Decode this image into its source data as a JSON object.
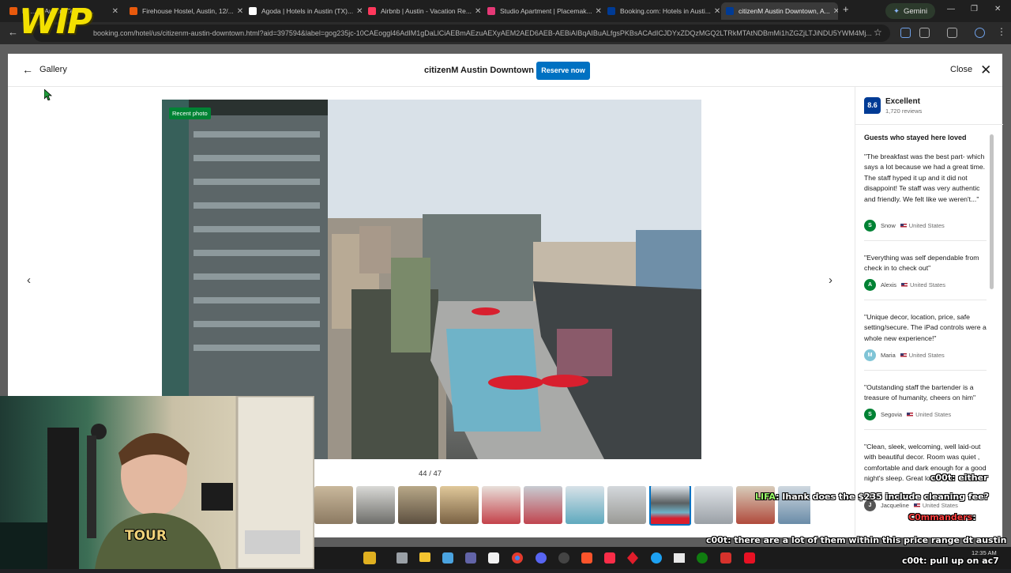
{
  "browser": {
    "tabs": [
      {
        "label": "Ba... in Austin, Texas, ...",
        "color": "#e8590c"
      },
      {
        "label": "Firehouse Hostel, Austin, 12/...",
        "color": "#e8590c"
      },
      {
        "label": "Agoda | Hotels in Austin (TX)...",
        "color": "#ffffff"
      },
      {
        "label": "Airbnb | Austin - Vacation Re...",
        "color": "#ff385c"
      },
      {
        "label": "Studio Apartment | Placemak...",
        "color": "#e53976"
      },
      {
        "label": "Booking.com: Hotels in Austi...",
        "color": "#003b95"
      },
      {
        "label": "citizenM Austin Downtown, A...",
        "color": "#003b95"
      }
    ],
    "gemini_label": "Gemini",
    "url": "booking.com/hotel/us/citizenm-austin-downtown.html?aid=397594&label=gog235jc-10CAEoggl46AdIM1gDaLlCiAEBmAEzuAEXyAEM2AED6AEB-AEBiAIBqAIBuALfgsPKBsACAdICJDYxZDQzMGQ2LTRkMTAtNDBmMi1hZGZjLTJiNDU5YWM4Mj..."
  },
  "modal": {
    "back_label": "Gallery",
    "title": "citizenM Austin Downtown",
    "reserve_label": "Reserve now",
    "close_label": "Close",
    "photo_badge": "Recent photo",
    "counter": "44 / 47",
    "thumbnail_count": 12,
    "selected_thumbnail": 8
  },
  "sidebar": {
    "score": "8.6",
    "rating_word": "Excellent",
    "reviews_count": "1,720 reviews",
    "loved_title": "Guests who stayed here loved",
    "reviews": [
      {
        "text": "\"The breakfast was the best part- which says a lot because we had a great time. The staff hyped it up and it did not disappoint! Te staff was very authentic and friendly. We felt like we weren't...\"",
        "name": "Snow",
        "initial": "S",
        "country": "United States",
        "avatar_color": "#008234"
      },
      {
        "text": "\"Everything was self dependable from check in to check out\"",
        "name": "Alexis",
        "initial": "A",
        "country": "United States",
        "avatar_color": "#008234"
      },
      {
        "text": "\"Unique decor, location, price, safe setting/secure. The iPad controls were a whole new experience!\"",
        "name": "Maria",
        "initial": "M",
        "country": "United States",
        "avatar_color": "#7fc4d6"
      },
      {
        "text": "\"Outstanding staff the bartender is a treasure of humanity, cheers on him\"",
        "name": "Segovia",
        "initial": "S",
        "country": "United States",
        "avatar_color": "#008234"
      },
      {
        "text": "\"Clean, sleek, welcoming, well laid-out with beautiful decor. Room was quiet , comfortable and dark enough for a good night's sleep. Great location.\"",
        "name": "Jacqueline",
        "initial": "J",
        "country": "United States",
        "avatar_color": "#555555"
      }
    ]
  },
  "stream": {
    "logo": "WIP",
    "shirt_text": "TOUR",
    "chat": [
      {
        "name": "c00t",
        "message": ": either"
      },
      {
        "name": "LIFA",
        "message": ": Ihank does the $235 include cleaning fee?"
      },
      {
        "name": "C0mmanders",
        "message": ":"
      },
      {
        "name": "c00t",
        "message": ": there are a lot of them within this price range dt austin"
      },
      {
        "name": "c00t",
        "message": ": pull up on ac7"
      }
    ]
  },
  "taskbar": {
    "time": "12:35 AM"
  }
}
